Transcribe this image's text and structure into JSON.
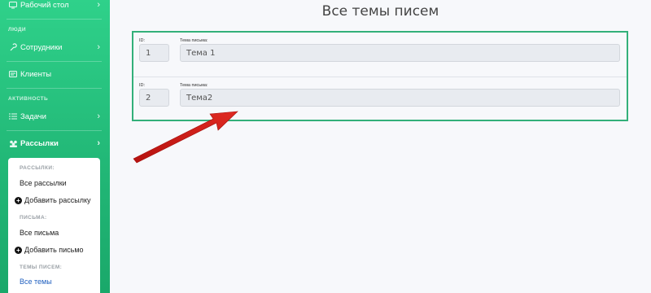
{
  "sidebar": {
    "desktop": "Рабочий стол",
    "section_people": "ЛЮДИ",
    "employees": "Сотрудники",
    "clients": "Клиенты",
    "section_activity": "АКТИВНОСТЬ",
    "tasks": "Задачи",
    "mailings": "Рассылки",
    "submenu": {
      "label_mailings": "РАССЫЛКИ:",
      "all_mailings": "Все рассылки",
      "add_mailing": "Добавить рассылку",
      "label_letters": "ПИСЬМА:",
      "all_letters": "Все письма",
      "add_letter": "Добавить письмо",
      "label_themes": "ТЕМЫ ПИСЕМ:",
      "all_themes": "Все темы"
    }
  },
  "main": {
    "title": "Все темы писем",
    "id_label": "ID:",
    "theme_label": "Тема письма:",
    "rows": [
      {
        "id": "1",
        "theme": "Тема 1"
      },
      {
        "id": "2",
        "theme": "Тема2"
      }
    ]
  },
  "colors": {
    "sidebar_top": "#2fd18a",
    "sidebar_bottom": "#1aa86a",
    "panel_border": "#33b07a",
    "annotation_arrow": "#d9221c"
  },
  "icons": {
    "desktop": "desktop-icon",
    "employees": "wrench-icon",
    "clients": "id-card-icon",
    "tasks": "list-icon",
    "mailings": "users-group-icon",
    "chevron": "chevron-right-icon",
    "add": "plus-circle-icon"
  }
}
